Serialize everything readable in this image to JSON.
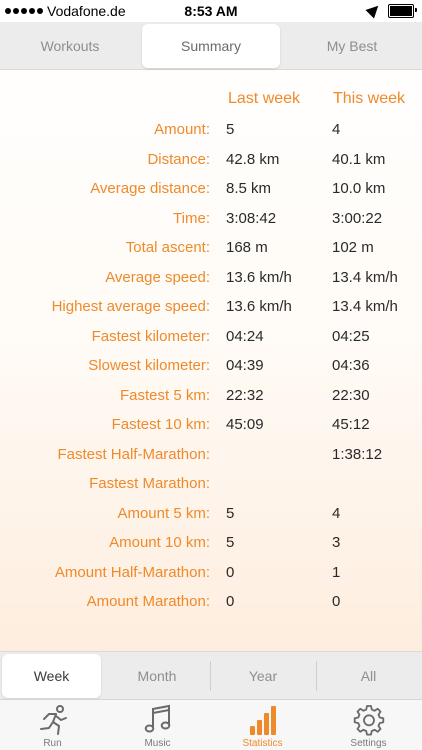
{
  "status_bar": {
    "carrier": "Vodafone.de",
    "time": "8:53 AM",
    "battery_level": 1.0
  },
  "top_tabs": [
    {
      "label": "Workouts",
      "active": false
    },
    {
      "label": "Summary",
      "active": true
    },
    {
      "label": "My Best",
      "active": false
    }
  ],
  "table": {
    "col1_header": "Last week",
    "col2_header": "This week",
    "rows": [
      {
        "label": "Amount:",
        "last": "5",
        "this": "4"
      },
      {
        "label": "Distance:",
        "last": "42.8 km",
        "this": "40.1 km"
      },
      {
        "label": "Average distance:",
        "last": "8.5 km",
        "this": "10.0 km"
      },
      {
        "label": "Time:",
        "last": "3:08:42",
        "this": "3:00:22"
      },
      {
        "label": "Total ascent:",
        "last": "168 m",
        "this": "102 m"
      },
      {
        "label": "Average speed:",
        "last": "13.6 km/h",
        "this": "13.4 km/h"
      },
      {
        "label": "Highest average speed:",
        "last": "13.6 km/h",
        "this": "13.4 km/h"
      },
      {
        "label": "Fastest kilometer:",
        "last": "04:24",
        "this": "04:25"
      },
      {
        "label": "Slowest kilometer:",
        "last": "04:39",
        "this": "04:36"
      },
      {
        "label": "Fastest 5 km:",
        "last": "22:32",
        "this": "22:30"
      },
      {
        "label": "Fastest 10 km:",
        "last": "45:09",
        "this": "45:12"
      },
      {
        "label": "Fastest Half-Marathon:",
        "last": "",
        "this": "1:38:12"
      },
      {
        "label": "Fastest Marathon:",
        "last": "",
        "this": ""
      },
      {
        "label": "Amount 5 km:",
        "last": "5",
        "this": "4"
      },
      {
        "label": "Amount 10 km:",
        "last": "5",
        "this": "3"
      },
      {
        "label": "Amount Half-Marathon:",
        "last": "0",
        "this": "1"
      },
      {
        "label": "Amount Marathon:",
        "last": "0",
        "this": "0"
      }
    ]
  },
  "period_tabs": [
    {
      "label": "Week",
      "active": true
    },
    {
      "label": "Month",
      "active": false
    },
    {
      "label": "Year",
      "active": false
    },
    {
      "label": "All",
      "active": false
    }
  ],
  "tab_bar": [
    {
      "label": "Run",
      "icon": "runner-icon",
      "active": false
    },
    {
      "label": "Music",
      "icon": "music-note-icon",
      "active": false
    },
    {
      "label": "Statistics",
      "icon": "bar-chart-icon",
      "active": true
    },
    {
      "label": "Settings",
      "icon": "gear-icon",
      "active": false
    }
  ],
  "colors": {
    "accent": "#ef8a2b",
    "value_text": "#2a2a2a",
    "tab_inactive": "#7a7a7a"
  }
}
